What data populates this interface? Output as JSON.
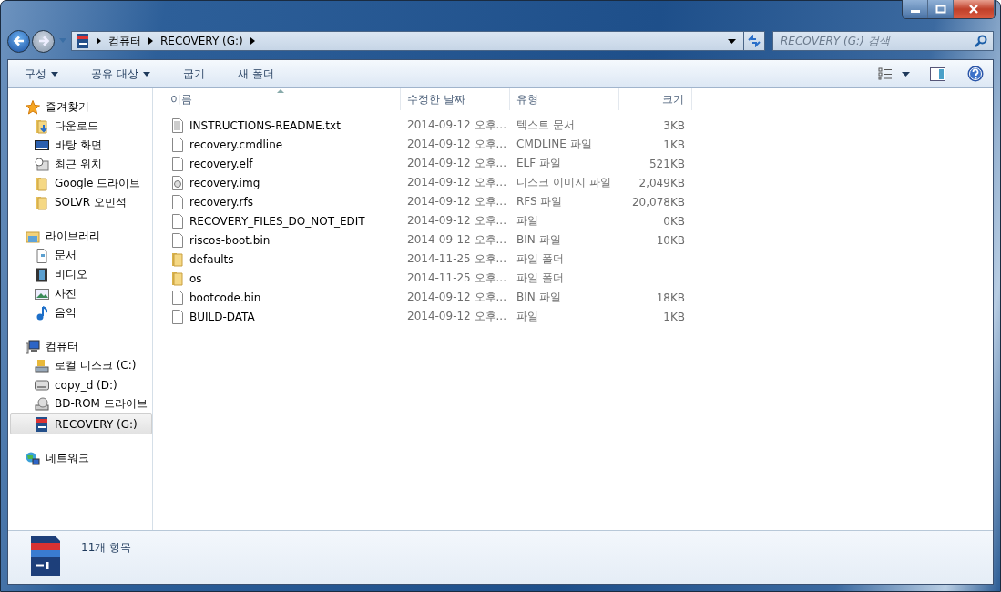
{
  "address": {
    "crumbs": [
      "컴퓨터",
      "RECOVERY (G:)"
    ]
  },
  "search": {
    "placeholder": "RECOVERY (G:) 검색"
  },
  "toolbar": {
    "items": [
      {
        "label": "구성",
        "dropdown": true
      },
      {
        "label": "공유 대상",
        "dropdown": true
      },
      {
        "label": "굽기",
        "dropdown": false
      },
      {
        "label": "새 폴더",
        "dropdown": false
      }
    ]
  },
  "sidebar": {
    "groups": [
      {
        "label": "즐겨찾기",
        "kind": "star",
        "children": [
          {
            "label": "다운로드",
            "kind": "download",
            "selected": false
          },
          {
            "label": "바탕 화면",
            "kind": "desktop",
            "selected": false
          },
          {
            "label": "최근 위치",
            "kind": "recent",
            "selected": false
          },
          {
            "label": "Google 드라이브",
            "kind": "folder",
            "selected": false
          },
          {
            "label": "SOLVR 오민석",
            "kind": "folder",
            "selected": false
          }
        ]
      },
      {
        "label": "라이브러리",
        "kind": "library",
        "children": [
          {
            "label": "문서",
            "kind": "document",
            "selected": false
          },
          {
            "label": "비디오",
            "kind": "video",
            "selected": false
          },
          {
            "label": "사진",
            "kind": "picture",
            "selected": false
          },
          {
            "label": "음악",
            "kind": "music",
            "selected": false
          }
        ]
      },
      {
        "label": "컴퓨터",
        "kind": "computer",
        "children": [
          {
            "label": "로컬 디스크 (C:)",
            "kind": "disk",
            "selected": false
          },
          {
            "label": "copy_d (D:)",
            "kind": "drive",
            "selected": false
          },
          {
            "label": "BD-ROM 드라이브",
            "kind": "optical",
            "selected": false
          },
          {
            "label": "RECOVERY (G:)",
            "kind": "sd",
            "selected": true
          }
        ]
      },
      {
        "label": "네트워크",
        "kind": "network"
      }
    ]
  },
  "table": {
    "columns": [
      "이름",
      "수정한 날짜",
      "유형",
      "크기"
    ],
    "rows": [
      {
        "kind": "text",
        "name": "INSTRUCTIONS-README.txt",
        "date": "2014-09-12 오후...",
        "type": "텍스트 문서",
        "size": "3KB"
      },
      {
        "kind": "file",
        "name": "recovery.cmdline",
        "date": "2014-09-12 오후...",
        "type": "CMDLINE 파일",
        "size": "1KB"
      },
      {
        "kind": "file",
        "name": "recovery.elf",
        "date": "2014-09-12 오후...",
        "type": "ELF 파일",
        "size": "521KB"
      },
      {
        "kind": "disc",
        "name": "recovery.img",
        "date": "2014-09-12 오후...",
        "type": "디스크 이미지 파일",
        "size": "2,049KB"
      },
      {
        "kind": "file",
        "name": "recovery.rfs",
        "date": "2014-09-12 오후...",
        "type": "RFS 파일",
        "size": "20,078KB"
      },
      {
        "kind": "file",
        "name": "RECOVERY_FILES_DO_NOT_EDIT",
        "date": "2014-09-12 오후...",
        "type": "파일",
        "size": "0KB"
      },
      {
        "kind": "file",
        "name": "riscos-boot.bin",
        "date": "2014-09-12 오후...",
        "type": "BIN 파일",
        "size": "10KB"
      },
      {
        "kind": "folder",
        "name": "defaults",
        "date": "2014-11-25 오후...",
        "type": "파일 폴더"
      },
      {
        "kind": "folder",
        "name": "os",
        "date": "2014-11-25 오후...",
        "type": "파일 폴더"
      },
      {
        "kind": "file",
        "name": "bootcode.bin",
        "date": "2014-09-12 오후...",
        "type": "BIN 파일",
        "size": "18KB"
      },
      {
        "kind": "file",
        "name": "BUILD-DATA",
        "date": "2014-09-12 오후...",
        "type": "파일",
        "size": "1KB"
      }
    ]
  },
  "status_bar": {
    "count": "11개 항목"
  }
}
